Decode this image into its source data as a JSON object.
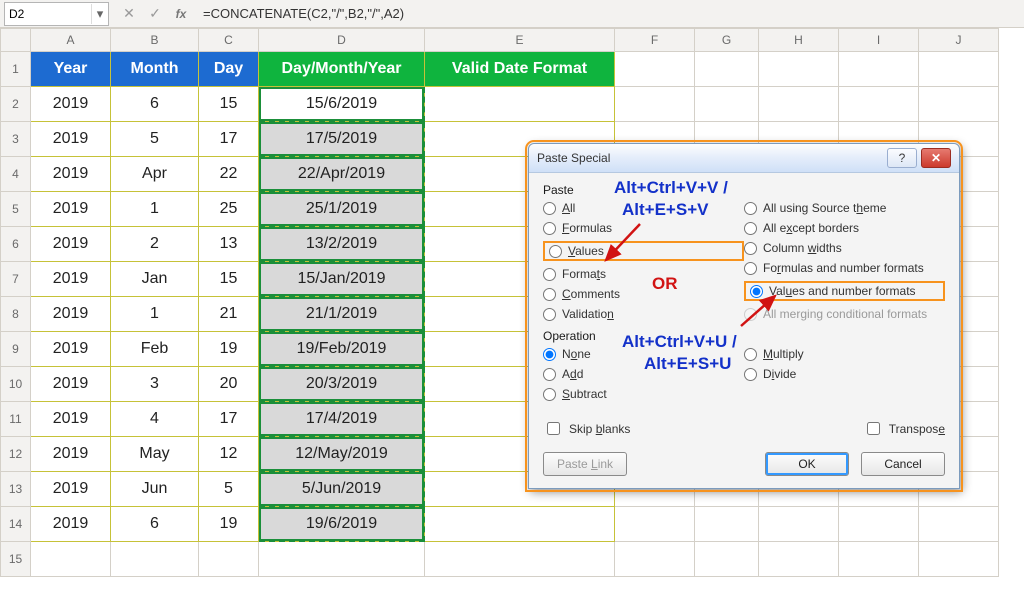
{
  "namebox": {
    "value": "D2"
  },
  "formula_bar": {
    "value": "=CONCATENATE(C2,\"/\",B2,\"/\",A2)"
  },
  "columns": [
    "A",
    "B",
    "C",
    "D",
    "E",
    "F",
    "G",
    "H",
    "I",
    "J"
  ],
  "headers": {
    "A": "Year",
    "B": "Month",
    "C": "Day",
    "D": "Day/Month/Year",
    "E": "Valid Date Format"
  },
  "rows": [
    {
      "n": "2",
      "year": "2019",
      "month": "6",
      "day": "15",
      "dmy": "15/6/2019"
    },
    {
      "n": "3",
      "year": "2019",
      "month": "5",
      "day": "17",
      "dmy": "17/5/2019"
    },
    {
      "n": "4",
      "year": "2019",
      "month": "Apr",
      "day": "22",
      "dmy": "22/Apr/2019"
    },
    {
      "n": "5",
      "year": "2019",
      "month": "1",
      "day": "25",
      "dmy": "25/1/2019"
    },
    {
      "n": "6",
      "year": "2019",
      "month": "2",
      "day": "13",
      "dmy": "13/2/2019"
    },
    {
      "n": "7",
      "year": "2019",
      "month": "Jan",
      "day": "15",
      "dmy": "15/Jan/2019"
    },
    {
      "n": "8",
      "year": "2019",
      "month": "1",
      "day": "21",
      "dmy": "21/1/2019"
    },
    {
      "n": "9",
      "year": "2019",
      "month": "Feb",
      "day": "19",
      "dmy": "19/Feb/2019"
    },
    {
      "n": "10",
      "year": "2019",
      "month": "3",
      "day": "20",
      "dmy": "20/3/2019"
    },
    {
      "n": "11",
      "year": "2019",
      "month": "4",
      "day": "17",
      "dmy": "17/4/2019"
    },
    {
      "n": "12",
      "year": "2019",
      "month": "May",
      "day": "12",
      "dmy": "12/May/2019"
    },
    {
      "n": "13",
      "year": "2019",
      "month": "Jun",
      "day": "5",
      "dmy": "5/Jun/2019"
    },
    {
      "n": "14",
      "year": "2019",
      "month": "6",
      "day": "19",
      "dmy": "19/6/2019"
    }
  ],
  "row15": "15",
  "dialog": {
    "title": "Paste Special",
    "paste_label": "Paste",
    "operation_label": "Operation",
    "opts_left": {
      "all": "All",
      "formulas": "Formulas",
      "values": "Values",
      "formats": "Formats",
      "comments": "Comments",
      "validation": "Validation"
    },
    "opts_right": {
      "src": "All using Source theme",
      "exb": "All except borders",
      "cw": "Column widths",
      "fnf": "Formulas and number formats",
      "vnf": "Values and number formats",
      "mcf": "All merging conditional formats"
    },
    "ops": {
      "none": "None",
      "add": "Add",
      "subtract": "Subtract",
      "multiply": "Multiply",
      "divide": "Divide"
    },
    "skip": "Skip blanks",
    "transpose": "Transpose",
    "paste_link": "Paste Link",
    "ok": "OK",
    "cancel": "Cancel",
    "selected_paste": "vnf",
    "selected_op": "none"
  },
  "annotations": {
    "line1a": "Alt+Ctrl+V+V /",
    "line1b": "Alt+E+S+V",
    "or": "OR",
    "line2a": "Alt+Ctrl+V+U /",
    "line2b": "Alt+E+S+U"
  }
}
